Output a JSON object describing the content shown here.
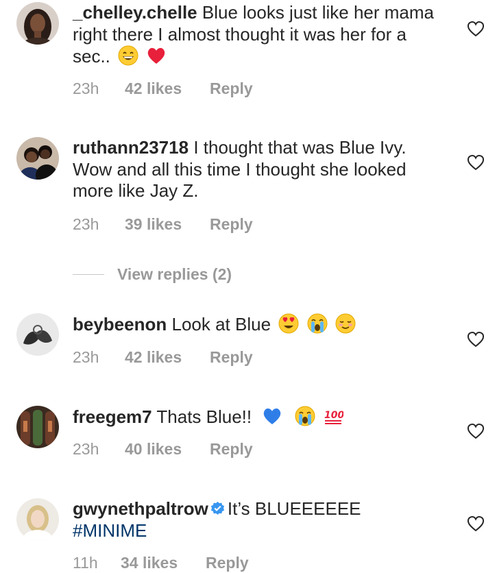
{
  "comments": [
    {
      "username": "_chelley.chelle",
      "text": "Blue looks just like her mama right there I almost thought it was her for a sec..",
      "emojis": [
        "grinning-face-emoji",
        "red-heart-emoji"
      ],
      "time": "23h",
      "likes": "42 likes",
      "reply": "Reply"
    },
    {
      "username": "ruthann23718",
      "text": "I thought that was Blue Ivy. Wow and all this time I thought she looked more like Jay Z.",
      "time": "23h",
      "likes": "39 likes",
      "reply": "Reply"
    },
    {
      "username": "beybeenon",
      "text": "Look at Blue",
      "emojis": [
        "heart-eyes-emoji",
        "crying-face-emoji",
        "smiling-blush-emoji"
      ],
      "time": "23h",
      "likes": "42 likes",
      "reply": "Reply"
    },
    {
      "username": "freegem7",
      "text": "Thats Blue!!",
      "emojis": [
        "blue-heart-emoji",
        "crying-face-emoji",
        "hundred-points-emoji"
      ],
      "time": "23h",
      "likes": "40 likes",
      "reply": "Reply"
    },
    {
      "username": "gwynethpaltrow",
      "verified": true,
      "text": "It’s BLUEEEEEE",
      "hashtag": "#MINIME",
      "time": "11h",
      "likes": "34 likes",
      "reply": "Reply"
    }
  ],
  "view_replies": "View replies (2)",
  "colors": {
    "text": "#262626",
    "muted": "#999999",
    "hashtag": "#003569",
    "verified": "#3897f0"
  }
}
